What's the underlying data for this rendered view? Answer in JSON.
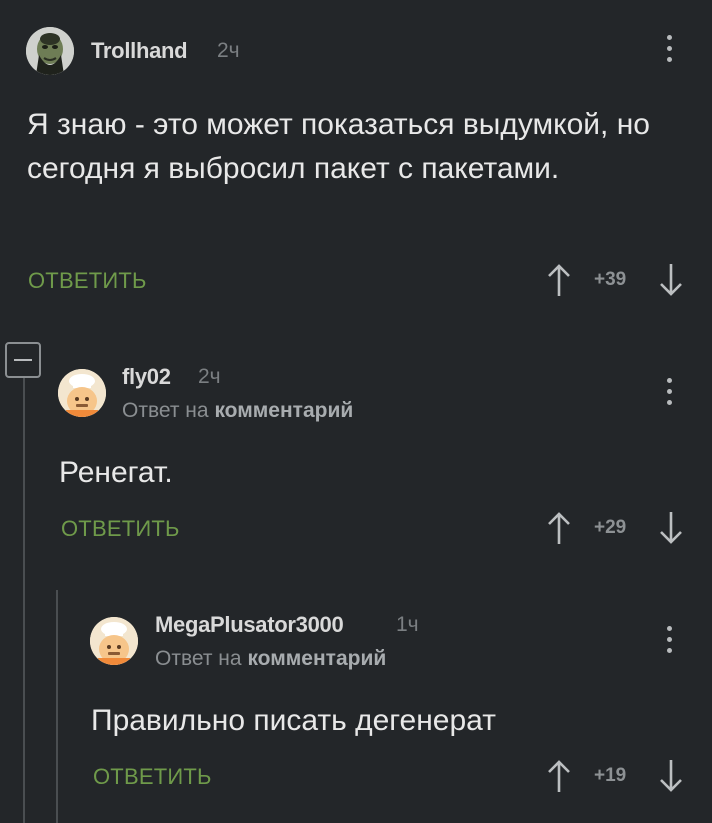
{
  "comments": [
    {
      "username": "Trollhand",
      "time": "2ч",
      "text": "Я знаю - это может показаться выдумкой, но сегодня я выбросил пакет с пакетами.",
      "reply_label": "ОТВЕТИТЬ",
      "score": "+39"
    },
    {
      "username": "fly02",
      "time": "2ч",
      "reply_prefix": "Ответ на",
      "reply_target": "комментарий",
      "text": "Ренегат.",
      "reply_label": "ОТВЕТИТЬ",
      "score": "+29"
    },
    {
      "username": "MegaPlusator3000",
      "time": "1ч",
      "reply_prefix": "Ответ на",
      "reply_target": "комментарий",
      "text": "Правильно писать дегенерат",
      "reply_label": "ОТВЕТИТЬ",
      "score": "+19"
    }
  ],
  "colors": {
    "background": "#232629",
    "reply_green": "#6f9a4a",
    "thread_line": "#4a4e51"
  },
  "icons": [
    "troll-avatar-icon",
    "chef-avatar-icon",
    "upvote-arrow-icon",
    "downvote-arrow-icon",
    "more-menu-icon",
    "collapse-icon"
  ]
}
